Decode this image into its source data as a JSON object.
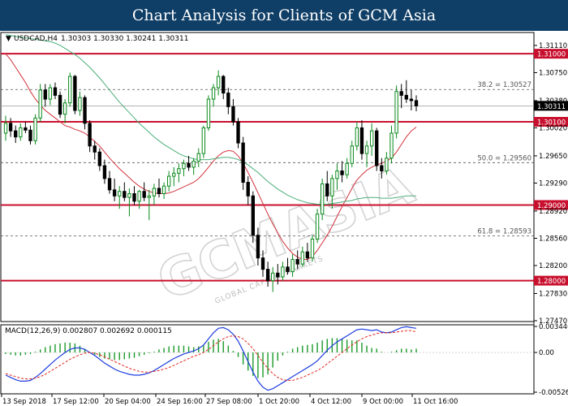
{
  "header": {
    "title": "Chart Analysis for Clients of GCM Asia"
  },
  "watermark": {
    "text": "GCMASIA",
    "sub": "GLOBAL CAPITAL MARKETS"
  },
  "colors": {
    "up": "#0a8a1c",
    "down": "#000000",
    "bull_wick": "#0a8a1c",
    "ma_red": "#d2323c",
    "ma_green": "#4caf7a",
    "level": "#c8102e",
    "price_tag": "#000000",
    "macd_main": "#1f3ee0",
    "macd_signal": "#e0281e",
    "macd_hist": "#1a9a2a"
  },
  "chart_data": [
    {
      "type": "candlestick",
      "title": "USDCAD,H4",
      "ohlc_label": "1.30303 1.30330 1.30241 1.30311",
      "x_tick_labels": [
        "13 Sep 2018",
        "17 Sep 12:00",
        "20 Sep 04:00",
        "24 Sep 16:00",
        "27 Sep 08:00",
        "1 Oct 20:00",
        "4 Oct 12:00",
        "9 Oct 00:00",
        "11 Oct 16:00"
      ],
      "y_tick_labels": [
        "1.31110",
        "1.30750",
        "1.30380",
        "1.30020",
        "1.29650",
        "1.29290",
        "1.28920",
        "1.28560",
        "1.28200",
        "1.27830",
        "1.27470"
      ],
      "ylim": [
        1.2747,
        1.3127
      ],
      "current_price": 1.30311,
      "current_price_label": "1.30311",
      "horizontal_levels": [
        {
          "value": 1.31,
          "label": "1.31000"
        },
        {
          "value": 1.301,
          "label": "1.30100"
        },
        {
          "value": 1.29,
          "label": "1.29000"
        },
        {
          "value": 1.28,
          "label": "1.28000"
        }
      ],
      "fibonacci_levels": [
        {
          "value": 1.30527,
          "label": "38.2 = 1.30527"
        },
        {
          "value": 1.2956,
          "label": "50.0 = 1.29560"
        },
        {
          "value": 1.28593,
          "label": "61.8 = 1.28593"
        }
      ],
      "series": [
        {
          "kind": "ohlc",
          "values": [
            [
              1.2995,
              1.3018,
              1.2985,
              1.3008
            ],
            [
              1.3008,
              1.3015,
              1.299,
              1.2998
            ],
            [
              1.2998,
              1.3005,
              1.2982,
              1.299
            ],
            [
              1.299,
              1.3008,
              1.2985,
              1.3002
            ],
            [
              1.3002,
              1.301,
              1.2995,
              1.2999
            ],
            [
              1.2999,
              1.3005,
              1.298,
              1.2985
            ],
            [
              1.2985,
              1.302,
              1.298,
              1.3015
            ],
            [
              1.3015,
              1.306,
              1.301,
              1.3052
            ],
            [
              1.3052,
              1.306,
              1.303,
              1.304
            ],
            [
              1.304,
              1.306,
              1.3032,
              1.3055
            ],
            [
              1.3055,
              1.3062,
              1.304,
              1.3045
            ],
            [
              1.3045,
              1.305,
              1.3015,
              1.302
            ],
            [
              1.302,
              1.304,
              1.3008,
              1.3035
            ],
            [
              1.3035,
              1.3075,
              1.303,
              1.307
            ],
            [
              1.307,
              1.3072,
              1.302,
              1.3025
            ],
            [
              1.3025,
              1.305,
              1.3018,
              1.3042
            ],
            [
              1.3042,
              1.3045,
              1.3,
              1.3008
            ],
            [
              1.3008,
              1.3012,
              1.297,
              1.2978
            ],
            [
              1.2978,
              1.2985,
              1.296,
              1.297
            ],
            [
              1.297,
              1.2975,
              1.2945,
              1.2952
            ],
            [
              1.2952,
              1.296,
              1.2928,
              1.2935
            ],
            [
              1.2935,
              1.2945,
              1.2915,
              1.292
            ],
            [
              1.292,
              1.2935,
              1.2905,
              1.2912
            ],
            [
              1.2912,
              1.2925,
              1.2895,
              1.2918
            ],
            [
              1.2918,
              1.293,
              1.2905,
              1.291
            ],
            [
              1.291,
              1.2922,
              1.2885,
              1.2915
            ],
            [
              1.2915,
              1.2925,
              1.29,
              1.2905
            ],
            [
              1.2905,
              1.292,
              1.2895,
              1.2918
            ],
            [
              1.2918,
              1.293,
              1.2905,
              1.291
            ],
            [
              1.291,
              1.292,
              1.288,
              1.2912
            ],
            [
              1.2912,
              1.2928,
              1.29,
              1.2922
            ],
            [
              1.2922,
              1.2935,
              1.291,
              1.2915
            ],
            [
              1.2915,
              1.293,
              1.2908,
              1.2925
            ],
            [
              1.2925,
              1.2945,
              1.2918,
              1.2938
            ],
            [
              1.2938,
              1.295,
              1.2925,
              1.2942
            ],
            [
              1.2942,
              1.2955,
              1.293,
              1.2948
            ],
            [
              1.2948,
              1.296,
              1.2938,
              1.2955
            ],
            [
              1.2955,
              1.2965,
              1.2945,
              1.295
            ],
            [
              1.295,
              1.2962,
              1.294,
              1.2958
            ],
            [
              1.2958,
              1.2975,
              1.295,
              1.2968
            ],
            [
              1.2968,
              1.3005,
              1.2962,
              1.3002
            ],
            [
              1.3002,
              1.3045,
              1.2998,
              1.304
            ],
            [
              1.304,
              1.306,
              1.303,
              1.3055
            ],
            [
              1.3055,
              1.3078,
              1.3045,
              1.307
            ],
            [
              1.307,
              1.3072,
              1.304,
              1.3048
            ],
            [
              1.3048,
              1.3055,
              1.302,
              1.303
            ],
            [
              1.303,
              1.304,
              1.3005,
              1.301
            ],
            [
              1.301,
              1.3015,
              1.2975,
              1.2982
            ],
            [
              1.2982,
              1.299,
              1.292,
              1.293
            ],
            [
              1.293,
              1.2938,
              1.29,
              1.2912
            ],
            [
              1.2912,
              1.2918,
              1.285,
              1.286
            ],
            [
              1.286,
              1.287,
              1.282,
              1.283
            ],
            [
              1.283,
              1.284,
              1.2805,
              1.2815
            ],
            [
              1.2815,
              1.2825,
              1.2792,
              1.28
            ],
            [
              1.28,
              1.2818,
              1.2785,
              1.281
            ],
            [
              1.281,
              1.2822,
              1.2795,
              1.2805
            ],
            [
              1.2805,
              1.2825,
              1.28,
              1.2818
            ],
            [
              1.2818,
              1.283,
              1.2808,
              1.2812
            ],
            [
              1.2812,
              1.2835,
              1.2805,
              1.2828
            ],
            [
              1.2828,
              1.284,
              1.2815,
              1.2822
            ],
            [
              1.2822,
              1.2845,
              1.2818,
              1.2838
            ],
            [
              1.2838,
              1.285,
              1.2825,
              1.283
            ],
            [
              1.283,
              1.286,
              1.2825,
              1.2855
            ],
            [
              1.2855,
              1.2895,
              1.285,
              1.2888
            ],
            [
              1.2888,
              1.2935,
              1.288,
              1.2928
            ],
            [
              1.2928,
              1.2945,
              1.2905,
              1.2912
            ],
            [
              1.2912,
              1.294,
              1.2895,
              1.2935
            ],
            [
              1.2935,
              1.2955,
              1.292,
              1.2945
            ],
            [
              1.2945,
              1.2958,
              1.293,
              1.294
            ],
            [
              1.294,
              1.2962,
              1.2935,
              1.2955
            ],
            [
              1.2955,
              1.2985,
              1.295,
              1.2978
            ],
            [
              1.2978,
              1.301,
              1.2972,
              1.3002
            ],
            [
              1.3002,
              1.3012,
              1.296,
              1.2968
            ],
            [
              1.2968,
              1.2985,
              1.295,
              1.2978
            ],
            [
              1.2978,
              1.3008,
              1.2965,
              1.2998
            ],
            [
              1.2998,
              1.3002,
              1.2945,
              1.2952
            ],
            [
              1.2952,
              1.2962,
              1.2935,
              1.2945
            ],
            [
              1.2945,
              1.297,
              1.294,
              1.2962
            ],
            [
              1.2962,
              1.3005,
              1.2955,
              1.2995
            ],
            [
              1.2995,
              1.3058,
              1.2988,
              1.305
            ],
            [
              1.305,
              1.306,
              1.3028,
              1.3045
            ],
            [
              1.3045,
              1.3065,
              1.3035,
              1.304
            ],
            [
              1.304,
              1.3052,
              1.3025,
              1.3038
            ],
            [
              1.3038,
              1.3045,
              1.3024,
              1.3031
            ]
          ]
        },
        {
          "kind": "ma",
          "name": "MA red",
          "values": [
            1.31,
            1.3092,
            1.3082,
            1.3072,
            1.3062,
            1.305,
            1.304,
            1.3032,
            1.3025,
            1.302,
            1.3015,
            1.301,
            1.3005,
            1.3003,
            1.3,
            1.2998,
            1.2995,
            1.299,
            1.2984,
            1.2978,
            1.297,
            1.2962,
            1.2955,
            1.2948,
            1.2942,
            1.2936,
            1.293,
            1.2925,
            1.2921,
            1.2918,
            1.2916,
            1.2915,
            1.2915,
            1.2916,
            1.2918,
            1.2921,
            1.2924,
            1.2927,
            1.293,
            1.2935,
            1.2942,
            1.295,
            1.2958,
            1.2965,
            1.297,
            1.2972,
            1.2971,
            1.2965,
            1.2955,
            1.2943,
            1.293,
            1.2916,
            1.2902,
            1.2888,
            1.2875,
            1.2863,
            1.2852,
            1.2843,
            1.2836,
            1.2831,
            1.2828,
            1.2828,
            1.2832,
            1.284,
            1.285,
            1.286,
            1.2872,
            1.2885,
            1.2898,
            1.291,
            1.2922,
            1.2933,
            1.294,
            1.2946,
            1.295,
            1.2953,
            1.2955,
            1.2958,
            1.2962,
            1.297,
            1.298,
            1.299,
            1.2998,
            1.3003
          ]
        },
        {
          "kind": "ma",
          "name": "MA green",
          "values": [
            1.3125,
            1.3124,
            1.3123,
            1.3122,
            1.3121,
            1.312,
            1.3119,
            1.3118,
            1.3117,
            1.3116,
            1.3114,
            1.3111,
            1.3107,
            1.3103,
            1.3099,
            1.3094,
            1.3088,
            1.3082,
            1.3075,
            1.3068,
            1.306,
            1.3052,
            1.3044,
            1.3036,
            1.3029,
            1.3022,
            1.3015,
            1.3008,
            1.3002,
            1.2996,
            1.299,
            1.2985,
            1.298,
            1.2976,
            1.2972,
            1.2968,
            1.2965,
            1.2963,
            1.2961,
            1.296,
            1.296,
            1.296,
            1.2961,
            1.2962,
            1.2963,
            1.2963,
            1.2962,
            1.296,
            1.2957,
            1.2953,
            1.2948,
            1.2943,
            1.2937,
            1.2931,
            1.2926,
            1.2921,
            1.2917,
            1.2913,
            1.291,
            1.2907,
            1.2905,
            1.2903,
            1.2902,
            1.2901,
            1.2901,
            1.2901,
            1.2902,
            1.2903,
            1.2904,
            1.2905,
            1.2906,
            1.2908,
            1.2909,
            1.291,
            1.291,
            1.291,
            1.2909,
            1.2909,
            1.2909,
            1.291,
            1.2911,
            1.2912,
            1.2912,
            1.2912
          ]
        }
      ]
    },
    {
      "type": "line",
      "title": "MACD(12,26,9) 0.002807 0.002692 0.000115",
      "y_tick_labels": [
        "0.003446",
        "0.00",
        "-0.005260"
      ],
      "ylim": [
        -0.00526,
        0.003446
      ],
      "series": [
        {
          "name": "MACD",
          "values": [
            -0.003,
            -0.0033,
            -0.0036,
            -0.0038,
            -0.0038,
            -0.0037,
            -0.0033,
            -0.0028,
            -0.0022,
            -0.0016,
            -0.001,
            -0.0005,
            0.0,
            0.0004,
            0.0006,
            0.0006,
            0.0004,
            0.0,
            -0.0004,
            -0.0009,
            -0.0014,
            -0.0018,
            -0.0022,
            -0.0025,
            -0.0027,
            -0.0029,
            -0.003,
            -0.003,
            -0.0029,
            -0.0027,
            -0.0024,
            -0.002,
            -0.0016,
            -0.0012,
            -0.0008,
            -0.0005,
            -0.0002,
            0.0,
            0.0002,
            0.0005,
            0.001,
            0.0018,
            0.0026,
            0.0032,
            0.0033,
            0.003,
            0.0024,
            0.0015,
            0.0002,
            -0.0012,
            -0.0026,
            -0.0038,
            -0.0046,
            -0.005,
            -0.0048,
            -0.0044,
            -0.004,
            -0.0036,
            -0.0032,
            -0.0028,
            -0.0024,
            -0.002,
            -0.0016,
            -0.0011,
            -0.0004,
            0.0003,
            0.0009,
            0.0014,
            0.0018,
            0.0022,
            0.0026,
            0.003,
            0.0031,
            0.003,
            0.0029,
            0.003,
            0.0027,
            0.0026,
            0.0027,
            0.003,
            0.0033,
            0.0034,
            0.0033,
            0.0032
          ]
        },
        {
          "name": "Signal",
          "values": [
            -0.0028,
            -0.003,
            -0.0032,
            -0.0034,
            -0.0035,
            -0.0035,
            -0.0034,
            -0.0032,
            -0.0029,
            -0.0025,
            -0.0021,
            -0.0017,
            -0.0013,
            -0.0009,
            -0.0006,
            -0.0003,
            -0.0001,
            0.0,
            -0.0001,
            -0.0003,
            -0.0006,
            -0.0009,
            -0.0012,
            -0.0015,
            -0.0018,
            -0.0021,
            -0.0023,
            -0.0025,
            -0.0026,
            -0.0026,
            -0.0025,
            -0.0024,
            -0.0022,
            -0.002,
            -0.0017,
            -0.0014,
            -0.0011,
            -0.0008,
            -0.0005,
            -0.0003,
            0.0,
            0.0004,
            0.0009,
            0.0014,
            0.0018,
            0.0021,
            0.0022,
            0.0021,
            0.0018,
            0.0012,
            0.0005,
            -0.0004,
            -0.0013,
            -0.0021,
            -0.0028,
            -0.0033,
            -0.0036,
            -0.0037,
            -0.0037,
            -0.0035,
            -0.0033,
            -0.003,
            -0.0027,
            -0.0024,
            -0.002,
            -0.0015,
            -0.001,
            -0.0005,
            0.0,
            0.0005,
            0.001,
            0.0014,
            0.0018,
            0.0021,
            0.0023,
            0.0025,
            0.0026,
            0.0026,
            0.0026,
            0.0027,
            0.0028,
            0.0029,
            0.0029,
            0.0027
          ]
        }
      ]
    }
  ]
}
